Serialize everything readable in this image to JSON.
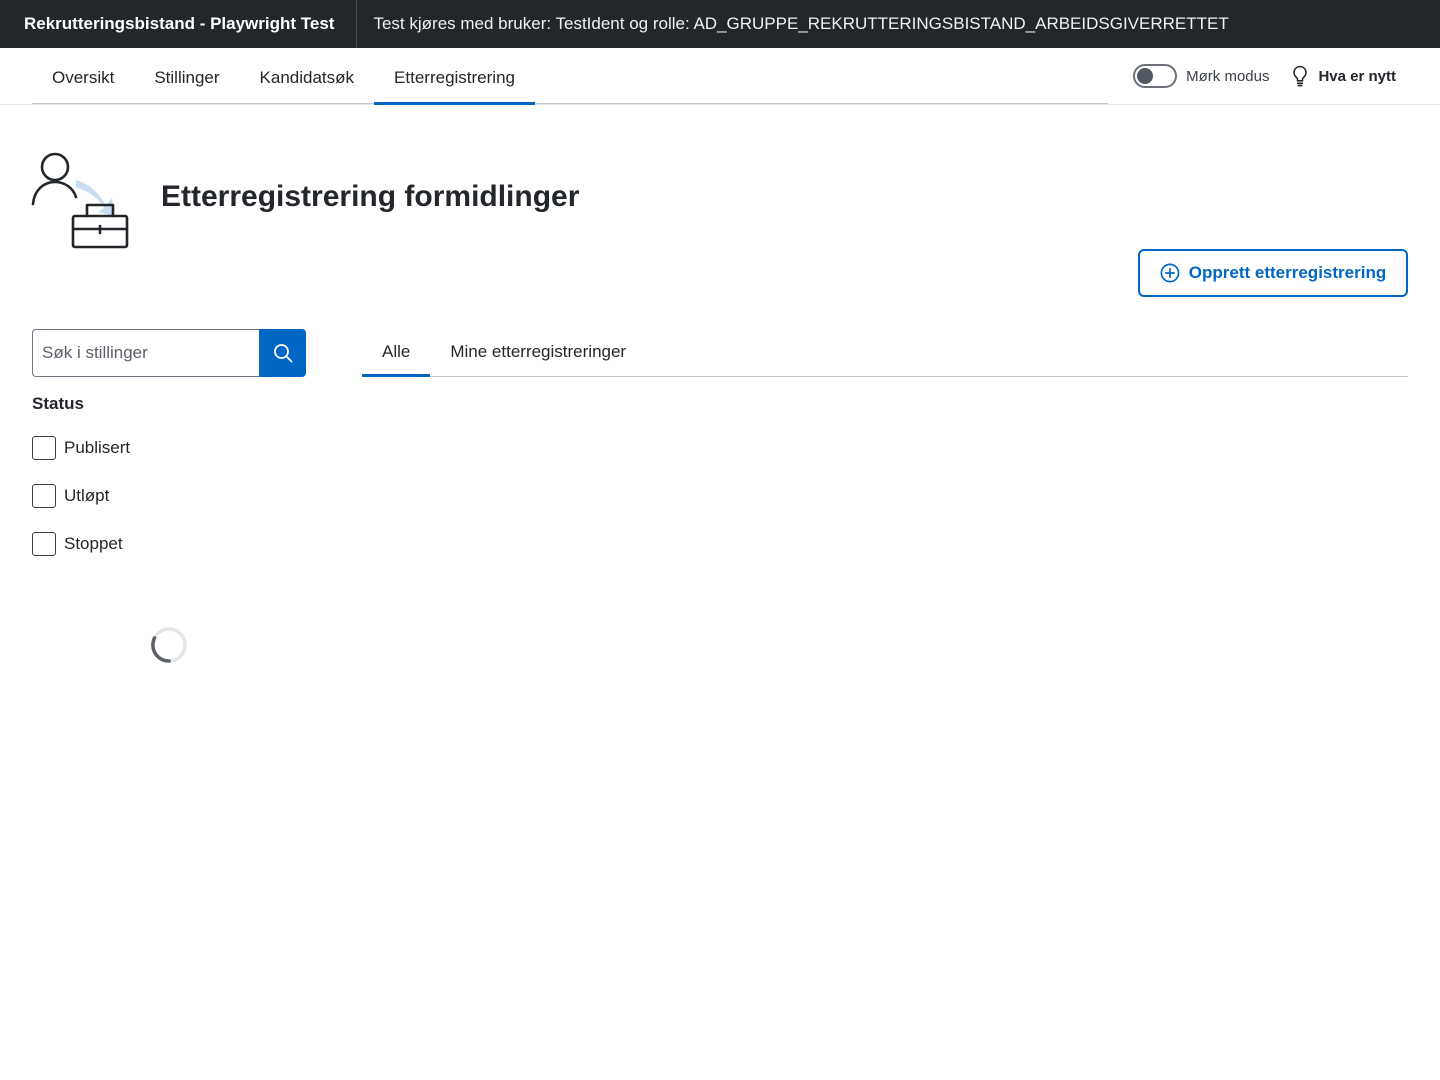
{
  "header": {
    "app_title": "Rekrutteringsbistand - Playwright Test",
    "test_info": "Test kjøres med bruker: TestIdent og rolle: AD_GRUPPE_REKRUTTERINGSBISTAND_ARBEIDSGIVERRETTET"
  },
  "nav": {
    "tabs": [
      {
        "label": "Oversikt",
        "active": false
      },
      {
        "label": "Stillinger",
        "active": false
      },
      {
        "label": "Kandidatsøk",
        "active": false
      },
      {
        "label": "Etterregistrering",
        "active": true
      }
    ],
    "dark_mode_label": "Mørk modus",
    "dark_mode_on": false,
    "whats_new_label": "Hva er nytt"
  },
  "page": {
    "title": "Etterregistrering formidlinger",
    "create_button_label": "Opprett etterregistrering"
  },
  "search": {
    "placeholder": "Søk i stillinger",
    "value": ""
  },
  "filter": {
    "heading": "Status",
    "options": [
      {
        "label": "Publisert",
        "checked": false
      },
      {
        "label": "Utløpt",
        "checked": false
      },
      {
        "label": "Stoppet",
        "checked": false
      }
    ]
  },
  "content_tabs": [
    {
      "label": "Alle",
      "active": true
    },
    {
      "label": "Mine etterregistreringer",
      "active": false
    }
  ],
  "colors": {
    "accent": "#0067c5",
    "header_bg": "#23262a"
  },
  "icons": {
    "hero": "person-briefcase-icon",
    "search": "search-icon",
    "create": "plus-circle-icon",
    "whats_new": "lightbulb-icon",
    "loading": "spinner-icon"
  }
}
